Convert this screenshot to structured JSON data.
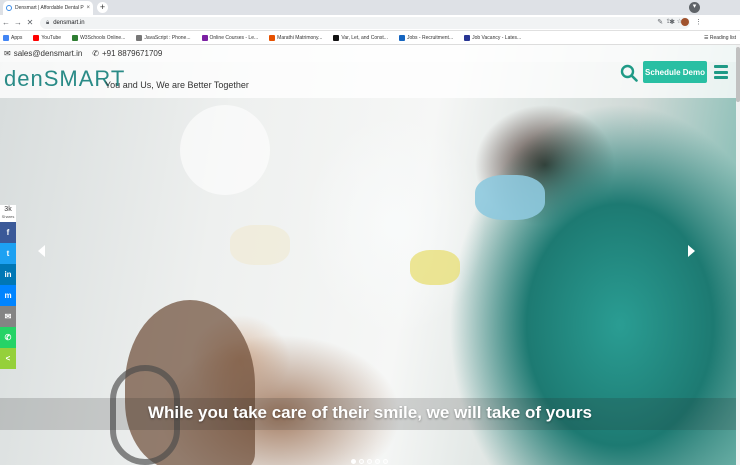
{
  "browser": {
    "tab_title": "Densmart | Affordable Dental Pr...",
    "tab_close": "×",
    "new_tab": "+",
    "url": "densmart.in",
    "reading_list": "Reading list",
    "bookmarks": [
      {
        "label": "Apps",
        "icon": "apps-grid-icon",
        "color": "#4285f4"
      },
      {
        "label": "YouTube",
        "icon": "youtube-icon",
        "color": "#ff0000"
      },
      {
        "label": "W3Schools Online...",
        "icon": "w3schools-icon",
        "color": "#2e7d32"
      },
      {
        "label": "JavaScript : Phone...",
        "icon": "code-icon",
        "color": "#777777"
      },
      {
        "label": "Online Courses - Le...",
        "icon": "courses-icon",
        "color": "#7b1fa2"
      },
      {
        "label": "Marathi Matrimony...",
        "icon": "matrimony-icon",
        "color": "#e65100"
      },
      {
        "label": "Var, Let, and Const...",
        "icon": "medium-icon",
        "color": "#111111"
      },
      {
        "label": "Jobs - Recruitment...",
        "icon": "jobs-icon",
        "color": "#1565c0"
      },
      {
        "label": "Job Vacancy - Lates...",
        "icon": "vacancy-icon",
        "color": "#283593"
      }
    ]
  },
  "site": {
    "email": "sales@densmart.in",
    "phone": "+91 8879671709",
    "logo": "denSMART",
    "tagline": "You and Us, We are Better Together",
    "cta": "Schedule Demo",
    "share_count": "3k",
    "share_label": "Shares",
    "share_buttons": [
      {
        "name": "facebook",
        "glyph": "f",
        "color": "#3b5998"
      },
      {
        "name": "twitter",
        "glyph": "t",
        "color": "#1da1f2"
      },
      {
        "name": "linkedin",
        "glyph": "in",
        "color": "#0077b5"
      },
      {
        "name": "messenger",
        "glyph": "m",
        "color": "#0084ff"
      },
      {
        "name": "email",
        "glyph": "✉",
        "color": "#848484"
      },
      {
        "name": "whatsapp",
        "glyph": "✆",
        "color": "#25d366"
      },
      {
        "name": "sharethis",
        "glyph": "<",
        "color": "#95d03a"
      }
    ],
    "slide_caption": "While you take care of their smile, we will take of yours",
    "slide_count": 5,
    "active_slide": 1,
    "brand_color": "#2a8b87",
    "cta_color": "#29bfa3"
  }
}
